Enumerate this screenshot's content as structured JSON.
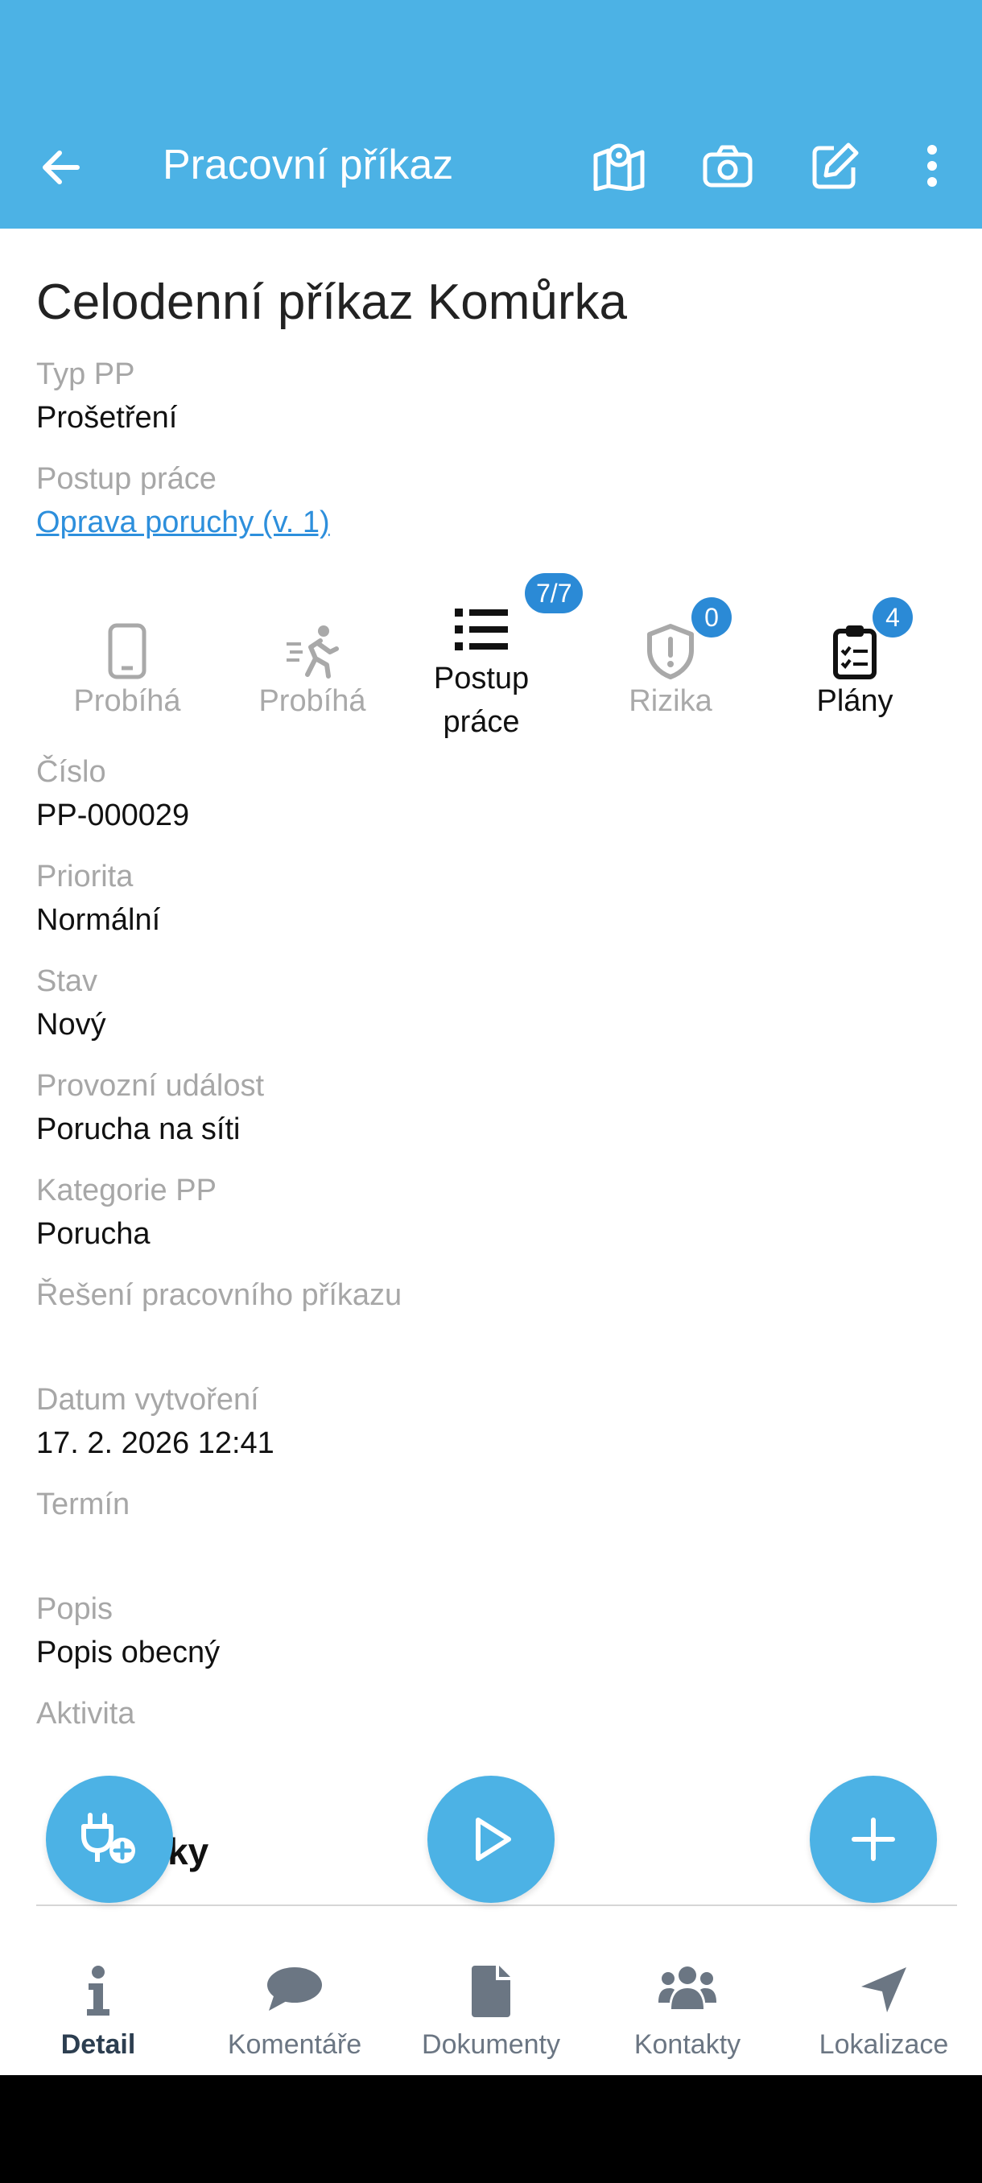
{
  "appbar": {
    "title": "Pracovní příkaz"
  },
  "heading": "Celodenní příkaz Komůrka",
  "top_fields": [
    {
      "label": "Typ PP",
      "value": "Prošetření"
    },
    {
      "label": "Postup práce",
      "value": "Oprava poruchy (v. 1)"
    }
  ],
  "chips": [
    {
      "label": "Probíhá",
      "icon": "phone-icon"
    },
    {
      "label": "Probíhá",
      "icon": "running-person-icon"
    },
    {
      "label": "Postup\npráce",
      "icon": "list-icon",
      "badge": "7/7"
    },
    {
      "label": "Rizika",
      "icon": "shield-alert-icon",
      "badge": "0"
    },
    {
      "label": "Plány",
      "icon": "clipboard-check-icon",
      "badge": "4"
    }
  ],
  "fields": [
    {
      "label": "Číslo",
      "value": "PP-000029"
    },
    {
      "label": "Priorita",
      "value": "Normální"
    },
    {
      "label": "Stav",
      "value": "Nový"
    },
    {
      "label": "Provozní událost",
      "value": "Porucha na síti"
    },
    {
      "label": "Kategorie PP",
      "value": "Porucha"
    },
    {
      "label": "Řešení pracovního příkazu",
      "value": ""
    },
    {
      "label": "Datum vytvoření",
      "value": "17. 2. 2026 12:41"
    },
    {
      "label": "Termín",
      "value": ""
    },
    {
      "label": "Popis",
      "value": "Popis obecný"
    },
    {
      "label": "Aktivita",
      "value": ""
    }
  ],
  "section_partial": "ítky",
  "bottom_nav": [
    {
      "label": "Detail",
      "icon": "info-icon",
      "active": true
    },
    {
      "label": "Komentáře",
      "icon": "comment-icon"
    },
    {
      "label": "Dokumenty",
      "icon": "document-icon"
    },
    {
      "label": "Kontakty",
      "icon": "users-icon"
    },
    {
      "label": "Lokalizace",
      "icon": "location-arrow-icon"
    }
  ],
  "colors": {
    "primary": "#4cb2e5",
    "badge": "#2b8ad6",
    "link": "#2d8fdc"
  }
}
